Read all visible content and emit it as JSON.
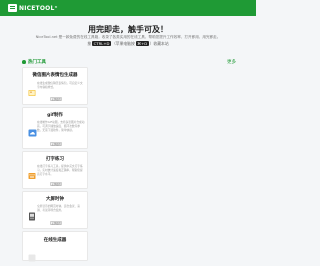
{
  "header": {
    "logo_text": "NICETOOL",
    "logo_sup": "®",
    "brand_color": "#1f9a35"
  },
  "hero": {
    "title": "用完即走，触手可及！",
    "description": "NiceTool.net 是一款免费的在线工具箱，收录了各类实用的在线工具，帮助您提升工作效率，打开即用，用完即走。",
    "tip_prefix": "按",
    "tip_key1": "CTRL+D",
    "tip_middle": "（苹果电脑按",
    "tip_key2": "⌘+D",
    "tip_suffix": "）收藏本站"
  },
  "section": {
    "title": "热门工具",
    "more": "更多"
  },
  "cards": [
    {
      "title": "微信图片表情包生成器",
      "body": "在线生成微信聊天表情包，可自定义文字内容和样式。",
      "button": "立即使用",
      "icon": "image-icon"
    },
    {
      "title": "gif制作",
      "body": "在线制作GIF动图，支持多张图片合成动画，可调节播放速度、循环次数等参数，无需下载软件，简单快捷。",
      "button": "立即使用",
      "icon": "cloud-icon"
    },
    {
      "title": "打字练习",
      "body": "在线打字练习工具，提供中英文打字练习，实时统计速度和正确率，帮助您提高打字水平。",
      "button": "立即使用",
      "icon": "keyboard-icon"
    },
    {
      "title": "大屏时钟",
      "body": "全屏显示的网页时钟，适合会议、演讲、考试等场合使用。",
      "button": "立即使用",
      "icon": "clock-icon"
    },
    {
      "title": "在线生成器",
      "body": "",
      "button": "",
      "icon": "tool-icon"
    }
  ]
}
